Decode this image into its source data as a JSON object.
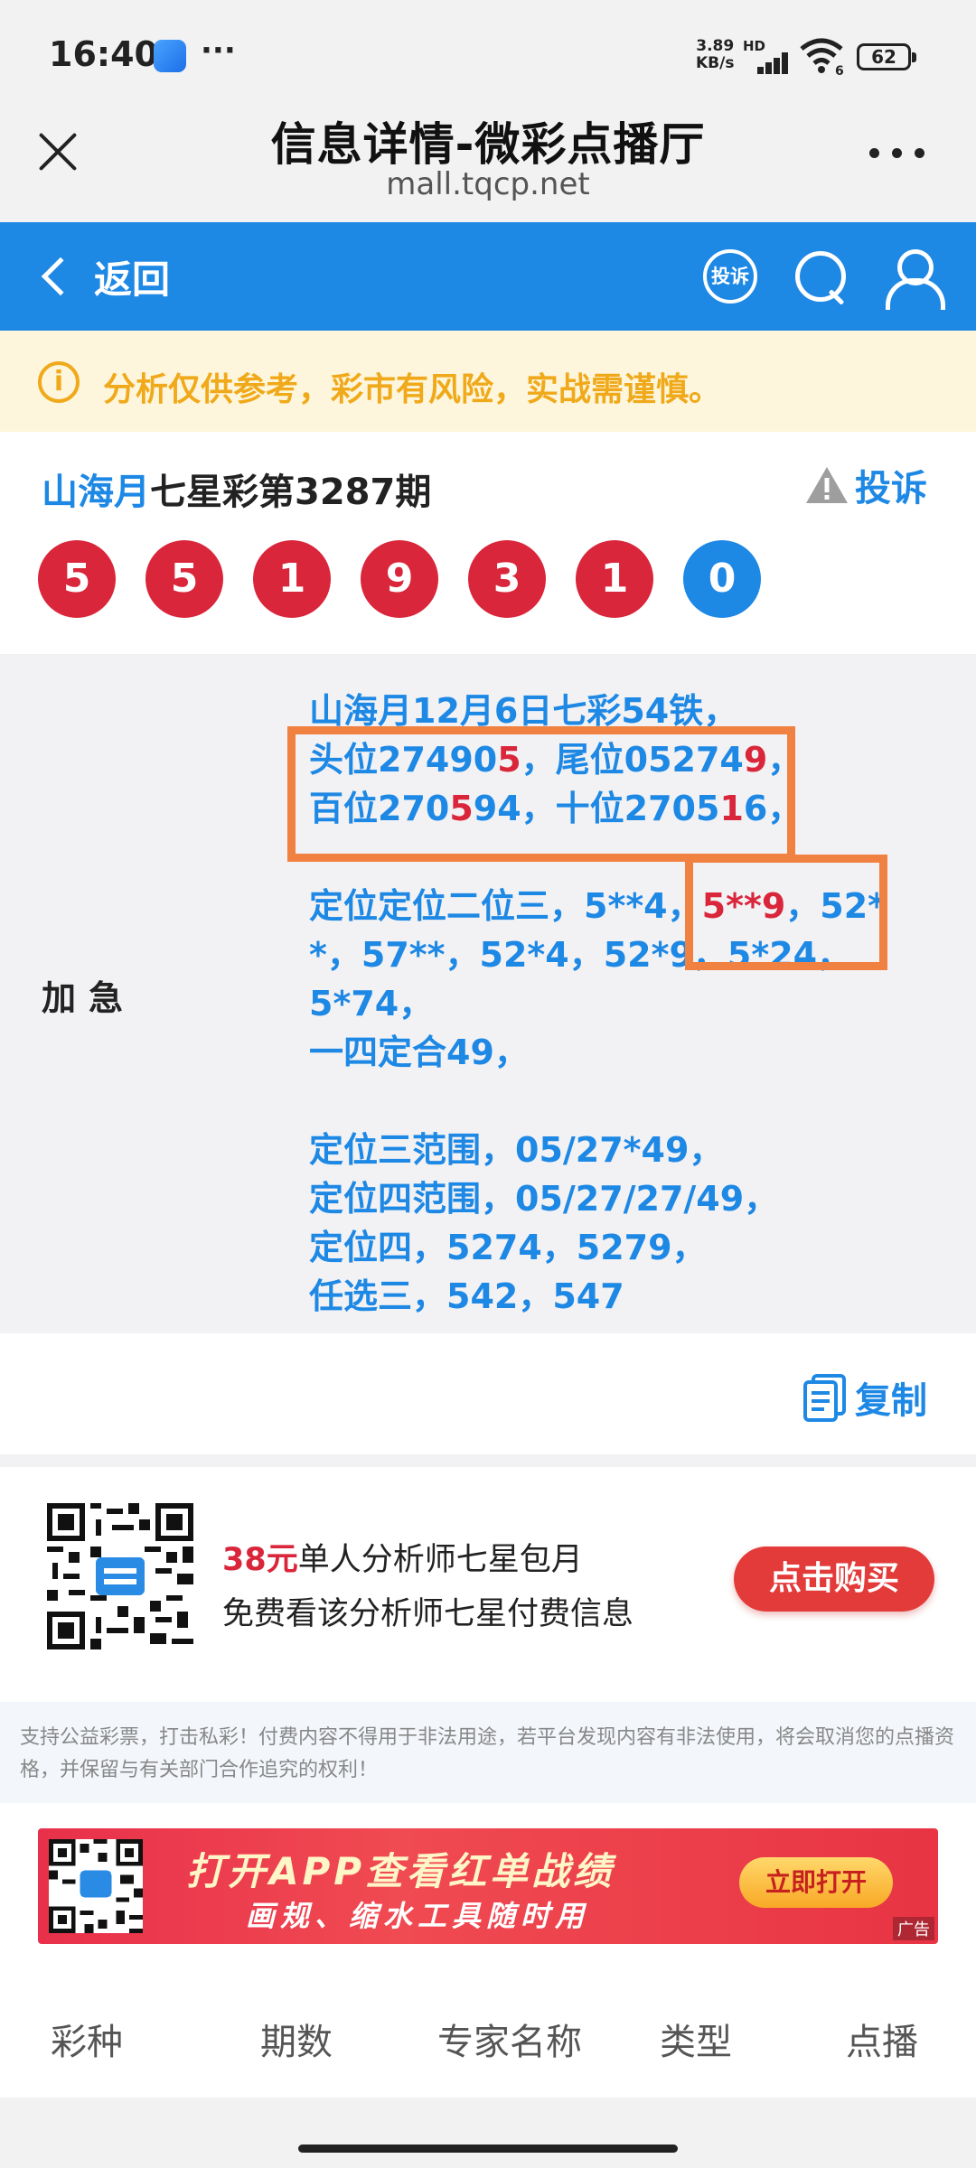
{
  "status_bar": {
    "time": "16:40",
    "dots": "···",
    "net_speed_value": "3.89",
    "net_speed_unit": "KB/s",
    "hd": "HD",
    "wifi_label": "6",
    "battery": "62"
  },
  "browser": {
    "title": "信息详情-微彩点播厅",
    "url": "mall.tqcp.net"
  },
  "nav": {
    "back_label": "返回",
    "complaint_icon_label": "投诉",
    "icons": [
      "complaint-icon",
      "search-icon",
      "user-icon"
    ],
    "color": "#1e88e5"
  },
  "notice": {
    "text": "分析仅供参考，彩市有风险，实战需谨慎。"
  },
  "lottery": {
    "analyst": "山海月",
    "issue_title": "七星彩第3287期",
    "complaint_label": "投诉",
    "balls": [
      {
        "value": "5",
        "color": "red"
      },
      {
        "value": "5",
        "color": "red"
      },
      {
        "value": "1",
        "color": "red"
      },
      {
        "value": "9",
        "color": "red"
      },
      {
        "value": "3",
        "color": "red"
      },
      {
        "value": "1",
        "color": "red"
      },
      {
        "value": "0",
        "color": "blue"
      }
    ]
  },
  "prediction": {
    "label": "加急",
    "line1": "山海月12月6日七彩54铁，",
    "line2_a": "头位27490",
    "line2_b": "5",
    "line2_c": "，尾位05274",
    "line2_d": "9",
    "line2_e": "，",
    "line3_a": "百位270",
    "line3_b": "5",
    "line3_c": "94，十位2705",
    "line3_d": "1",
    "line3_e": "6，",
    "line4_a": "定位定位二位三，5**4，",
    "line4_b": "5**9",
    "line4_c": "，52*",
    "line5": "*，57**，52*4，52*9，5*24，5*74，",
    "line6": "一四定合49，",
    "line7": "定位三范围，05/27*49，",
    "line8": "定位四范围，05/27/27/49，",
    "line9": "定位四，5274，5279，",
    "line10": "任选三，542，547"
  },
  "copy": {
    "label": "复制"
  },
  "subscribe": {
    "price": "38元",
    "title_rest": "单人分析师七星包月",
    "subtitle": "免费看该分析师七星付费信息",
    "button": "点击购买"
  },
  "disclaimer": {
    "text": "支持公益彩票，打击私彩！付费内容不得用于非法用途，若平台发现内容有非法使用，将会取消您的点播资格，并保留与有关部门合作追究的权利！"
  },
  "ad": {
    "title": "打开APP查看红单战绩",
    "subtitle": "画规、缩水工具随时用",
    "button": "立即打开",
    "tag": "广告"
  },
  "table_header": {
    "columns": [
      "彩种",
      "期数",
      "专家名称",
      "类型",
      "点播"
    ]
  }
}
